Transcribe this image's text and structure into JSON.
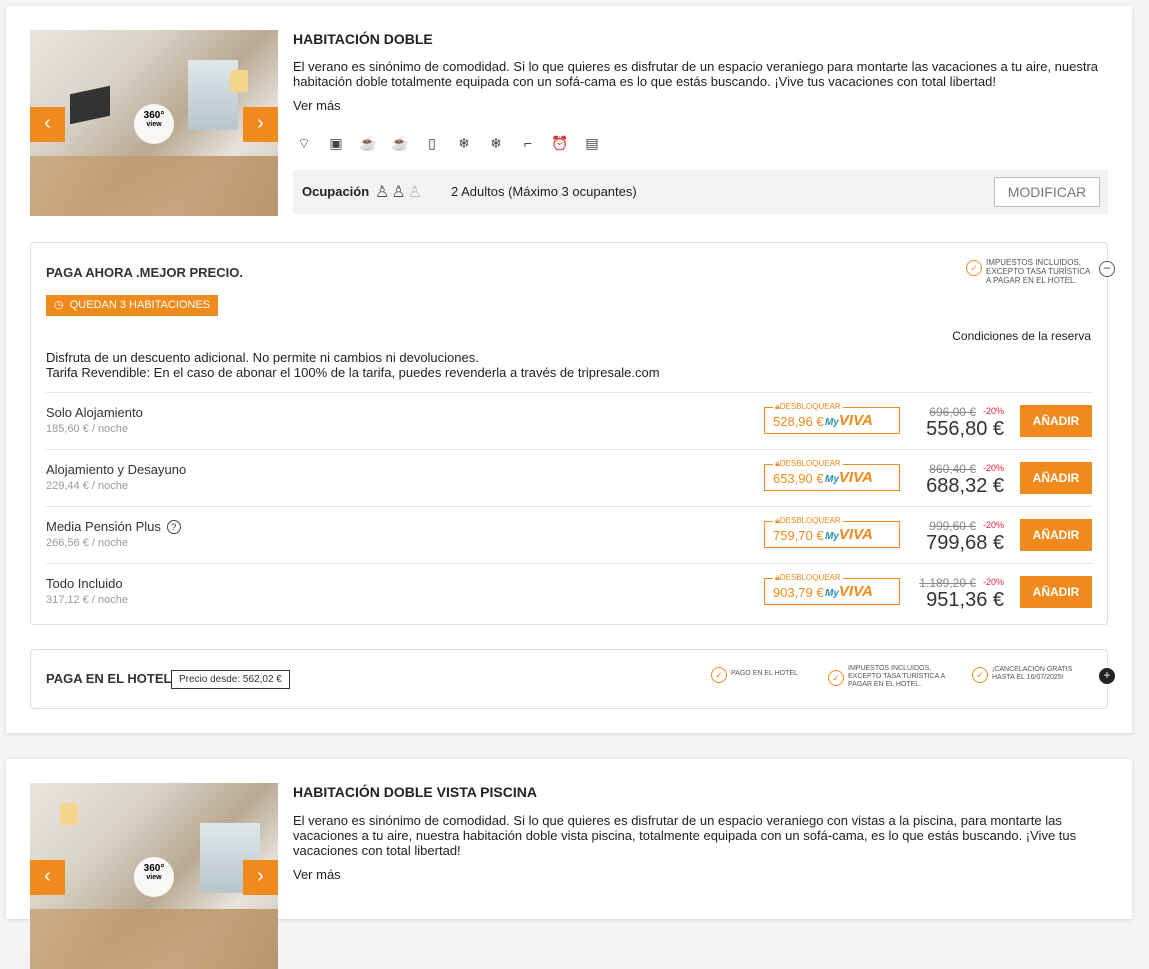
{
  "rooms": [
    {
      "title": "HABITACIÓN DOBLE",
      "description": "El verano es sinónimo de comodidad. Si lo que quieres es disfrutar de un espacio veraniego para montarte las vacaciones a tu aire, nuestra habitación doble totalmente equipada con un sofá-cama es lo que estás buscando. ¡Vive tus vacaciones con total libertad!",
      "ver_mas": "Ver más",
      "view360": "360°",
      "view360_sub": "view",
      "amenity_icons": [
        "wifi-icon",
        "safe-icon",
        "coffee-icon",
        "kettle-icon",
        "fridge-icon",
        "ac-icon",
        "heating-icon",
        "hairdryer-icon",
        "alarm-icon",
        "bathroom-icon"
      ],
      "occupation_label": "Ocupación",
      "occupation_text": "2 Adultos (Máximo 3 ocupantes)",
      "modify_label": "MODIFICAR"
    },
    {
      "title": "HABITACIÓN DOBLE VISTA PISCINA",
      "description": "El verano es sinónimo de comodidad. Si lo que quieres es disfrutar de un espacio veraniego con vistas a la piscina, para montarte las vacaciones a tu aire, nuestra habitación doble vista piscina, totalmente equipada con un sofá-cama, es lo que estás buscando. ¡Vive tus vacaciones con total libertad!",
      "ver_mas": "Ver más",
      "view360": "360°",
      "view360_sub": "view"
    }
  ],
  "pay_now": {
    "title": "PAGA AHORA .MEJOR PRECIO.",
    "tax_note": "IMPUESTOS INCLUIDOS, EXCEPTO TASA TURÍSTICA A PAGAR EN EL HOTEL.",
    "quedan": "QUEDAN 3 HABITACIONES",
    "conditions": "Condiciones de la reserva",
    "desc_line1": "Disfruta de un descuento adicional. No permite ni cambios ni devoluciones.",
    "desc_line2": "Tarifa Revendible: En el caso de abonar el 100% de la tarifa, puedes revenderla a través de tripresale.com",
    "unlock_label": "DESBLOQUEAR",
    "myviva_my": "My",
    "myviva_name": "VIVA",
    "add_label": "AÑADIR",
    "rows": [
      {
        "name": "Solo Alojamiento",
        "per_night": "185,60 € / noche",
        "myviva_price": "528,96 €",
        "old_price": "696,00 €",
        "discount": "-20%",
        "price": "556,80 €"
      },
      {
        "name": "Alojamiento y Desayuno",
        "per_night": "229,44 € / noche",
        "myviva_price": "653,90 €",
        "old_price": "860,40 €",
        "discount": "-20%",
        "price": "688,32 €"
      },
      {
        "name": "Media Pensión Plus",
        "per_night": "266,56 € / noche",
        "myviva_price": "759,70 €",
        "old_price": "999,60 €",
        "discount": "-20%",
        "price": "799,68 €"
      },
      {
        "name": "Todo Incluido",
        "per_night": "317,12 € / noche",
        "myviva_price": "903,79 €",
        "old_price": "1.189,20 €",
        "discount": "-20%",
        "price": "951,36 €"
      }
    ]
  },
  "pay_hotel": {
    "title": "PAGA EN EL HOTEL",
    "desde": "Precio desde: 562,02 €",
    "feat1": "PAGO EN EL HOTEL",
    "feat2": "IMPUESTOS INCLUIDOS, EXCEPTO TASA TURÍSTICA A PAGAR EN EL HOTEL.",
    "feat3": "¡CANCELACIÓN GRATIS HASTA EL 16/07/2025!"
  },
  "colors": {
    "accent": "#f08a1c",
    "discount": "#e24444"
  }
}
